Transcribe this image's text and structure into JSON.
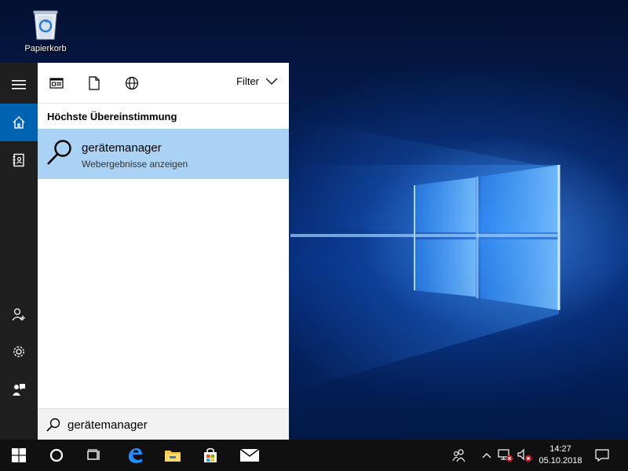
{
  "desktop": {
    "icons": [
      {
        "label": "Papierkorb",
        "icon": "recycle-bin-icon"
      }
    ]
  },
  "start_menu": {
    "rail": [
      {
        "icon": "hamburger-menu-icon",
        "active": false
      },
      {
        "icon": "home-icon",
        "active": true
      },
      {
        "icon": "notebook-icon",
        "active": false
      },
      {
        "icon": "add-person-icon",
        "active": false
      },
      {
        "icon": "gear-icon",
        "active": false
      },
      {
        "icon": "feedback-icon",
        "active": false
      }
    ],
    "scopes": [
      "apps-icon",
      "document-icon",
      "web-globe-icon"
    ],
    "filter_label": "Filter",
    "section_heading": "Höchste Übereinstimmung",
    "best_match": {
      "title": "gerätemanager",
      "subtitle": "Webergebnisse anzeigen",
      "icon": "search-icon"
    },
    "search": {
      "value": "gerätemanager",
      "placeholder": ""
    }
  },
  "taskbar": {
    "buttons": [
      "windows-start-icon",
      "cortana-circle-icon",
      "task-view-icon",
      "edge-icon",
      "file-explorer-icon",
      "store-icon",
      "mail-icon"
    ],
    "tray": [
      "people-icon",
      "chevron-up-icon",
      "network-error-icon",
      "volume-muted-icon"
    ],
    "clock": {
      "time": "14:27",
      "date": "05.10.2018"
    },
    "action_center": "action-center-icon"
  },
  "colors": {
    "accent": "#0063b1",
    "selection": "#a9d2f5",
    "taskbar": "#101010",
    "rail": "#1f1f1f"
  }
}
